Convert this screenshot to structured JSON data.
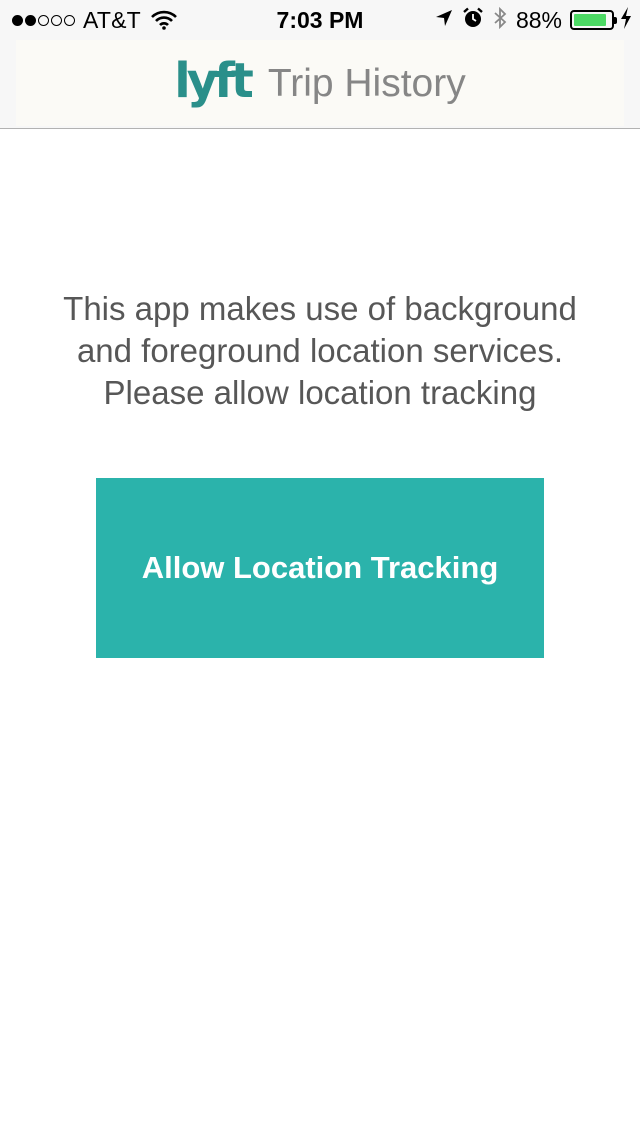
{
  "status_bar": {
    "signal_strength": {
      "filled": 2,
      "total": 5
    },
    "carrier": "AT&T",
    "time": "7:03 PM",
    "battery_percent": "88%",
    "battery_level": 0.88,
    "icons": [
      "wifi-icon",
      "location-arrow-icon",
      "alarm-clock-icon",
      "bluetooth-icon",
      "battery-icon",
      "charging-bolt-icon"
    ]
  },
  "header": {
    "logo_text": "lyft",
    "title": "Trip History"
  },
  "message": {
    "lines": [
      "This app makes use of background",
      "and foreground location services.",
      "Please allow location tracking"
    ]
  },
  "allow_button": {
    "label": "Allow Location Tracking"
  },
  "colors": {
    "accent": "#2bb3ab",
    "logo": "#2a8f8a",
    "battery": "#4cd964"
  }
}
